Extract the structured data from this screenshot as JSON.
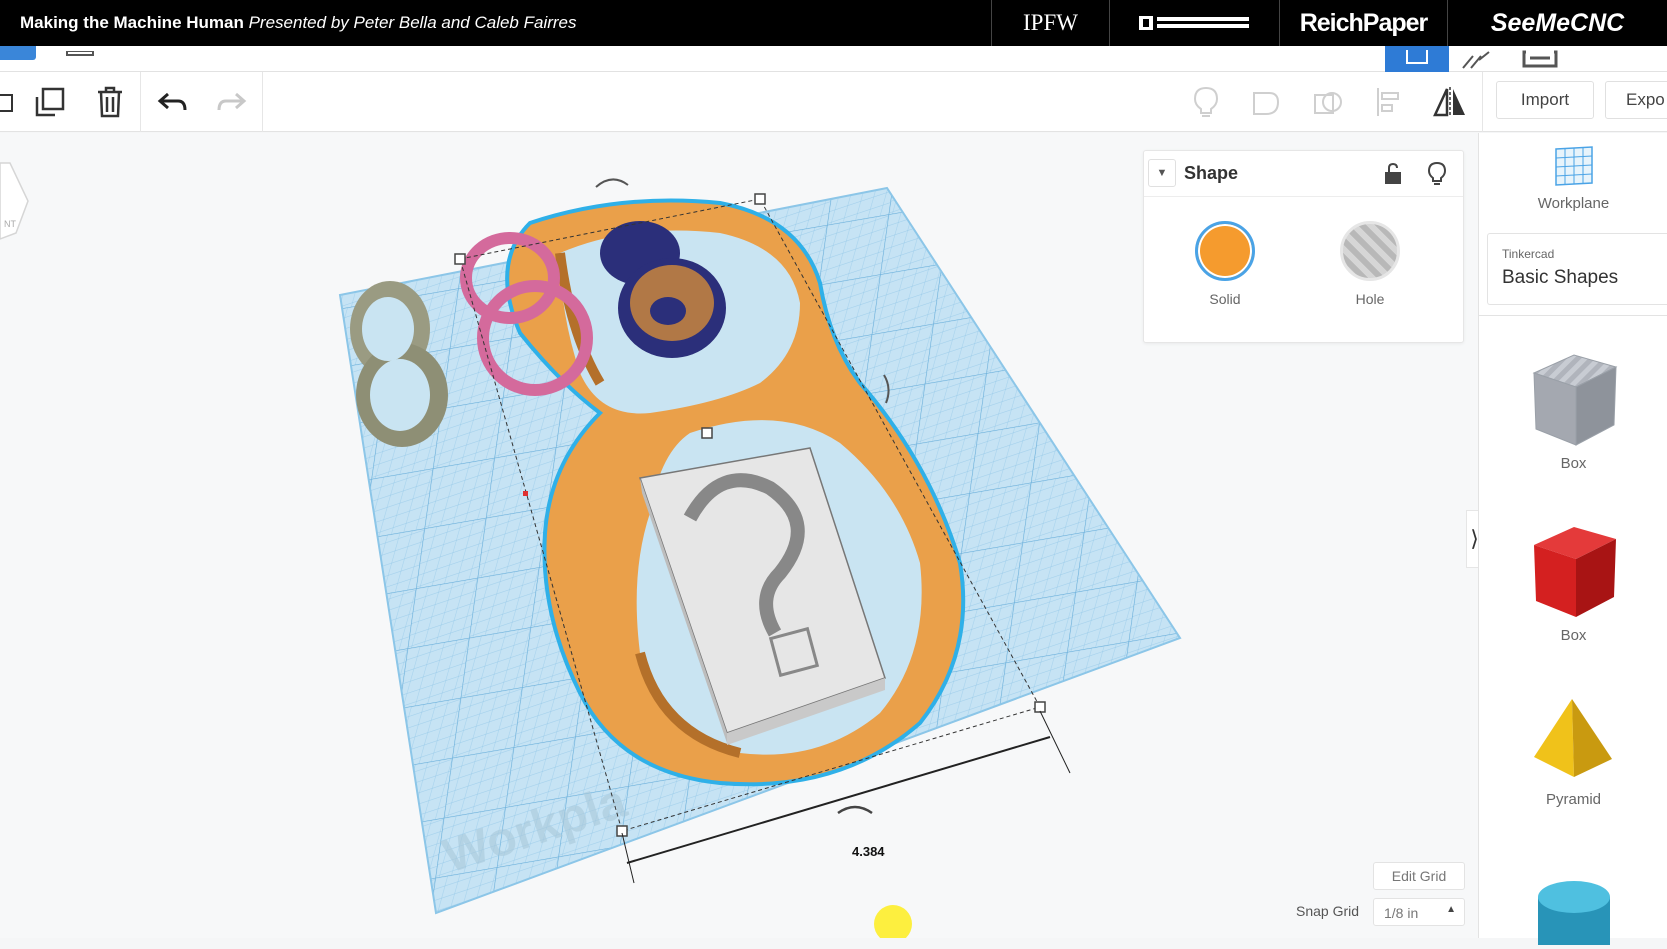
{
  "banner": {
    "title_bold": "Making the Machine Human",
    "title_rest": " Presented by Peter Bella and Caleb Fairres",
    "sponsors": [
      "IPFW",
      "PURDUE FORT WAYNE",
      "ReichPaper",
      "SeeMeCNC"
    ]
  },
  "toolbar": {
    "import_label": "Import",
    "export_label": "Expo"
  },
  "canvas": {
    "workplane_text": "Workpla",
    "dimension_value": "4.384",
    "corner_cube_text": "NT"
  },
  "inspector": {
    "title": "Shape",
    "solid_label": "Solid",
    "hole_label": "Hole",
    "solid_color": "#f59b2e",
    "hole_color": "#b8b8b8"
  },
  "grid_controls": {
    "edit_grid_label": "Edit Grid",
    "snap_grid_label": "Snap Grid",
    "snap_grid_value": "1/8 in"
  },
  "shapes_panel": {
    "workplane_label": "Workplane",
    "library_source": "Tinkercad",
    "library_name": "Basic Shapes",
    "items": [
      {
        "label": "Box",
        "color": "#b0b4bc"
      },
      {
        "label": "Box",
        "color": "#d42020"
      },
      {
        "label": "Pyramid",
        "color": "#e8b81a"
      },
      {
        "label": "",
        "color": "#2fa5c9"
      }
    ]
  },
  "colors": {
    "accent": "#2e7bd6",
    "orange": "#eaa04a",
    "workplane": "#9fd1ee",
    "navy": "#2b2f7a",
    "pink": "#d46a9c",
    "gray_shape": "#8e8f75"
  }
}
